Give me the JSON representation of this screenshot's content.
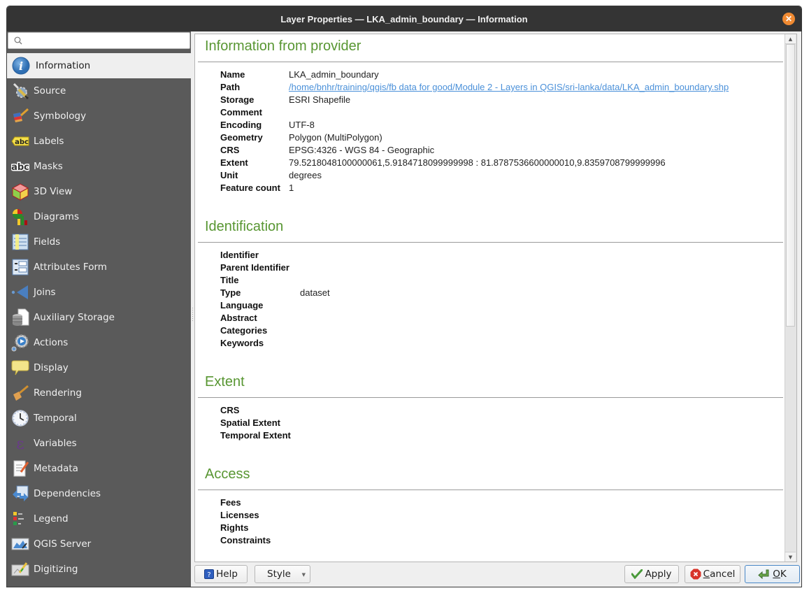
{
  "window": {
    "title": "Layer Properties — LKA_admin_boundary — Information",
    "close_label": "×"
  },
  "sidebar": {
    "search": {
      "value": "",
      "placeholder": ""
    },
    "items": [
      {
        "label": "Information",
        "icon": "info-icon",
        "active": true
      },
      {
        "label": "Source",
        "icon": "source-tools-icon"
      },
      {
        "label": "Symbology",
        "icon": "symbology-brush-icon"
      },
      {
        "label": "Labels",
        "icon": "labels-abc-icon"
      },
      {
        "label": "Masks",
        "icon": "masks-abc-icon"
      },
      {
        "label": "3D View",
        "icon": "cube-3d-icon"
      },
      {
        "label": "Diagrams",
        "icon": "diagrams-icon"
      },
      {
        "label": "Fields",
        "icon": "fields-table-icon"
      },
      {
        "label": "Attributes Form",
        "icon": "attributes-form-icon"
      },
      {
        "label": "Joins",
        "icon": "joins-icon"
      },
      {
        "label": "Auxiliary Storage",
        "icon": "auxiliary-storage-icon"
      },
      {
        "label": "Actions",
        "icon": "actions-gear-icon"
      },
      {
        "label": "Display",
        "icon": "display-speech-bubble-icon"
      },
      {
        "label": "Rendering",
        "icon": "rendering-brush-icon"
      },
      {
        "label": "Temporal",
        "icon": "temporal-clock-icon"
      },
      {
        "label": "Variables",
        "icon": "variables-epsilon-icon"
      },
      {
        "label": "Metadata",
        "icon": "metadata-document-icon"
      },
      {
        "label": "Dependencies",
        "icon": "dependencies-icon"
      },
      {
        "label": "Legend",
        "icon": "legend-icon"
      },
      {
        "label": "QGIS Server",
        "icon": "qgis-server-icon"
      },
      {
        "label": "Digitizing",
        "icon": "digitizing-icon"
      }
    ]
  },
  "content": {
    "sections": [
      {
        "title": "Information from provider",
        "rows": [
          {
            "key": "Name",
            "value": "LKA_admin_boundary"
          },
          {
            "key": "Path",
            "value": "/home/bnhr/training/qgis/fb data for good/Module 2 - Layers in QGIS/sri-lanka/data/LKA_admin_boundary.shp",
            "link": true
          },
          {
            "key": "Storage",
            "value": "ESRI Shapefile"
          },
          {
            "key": "Comment",
            "value": ""
          },
          {
            "key": "Encoding",
            "value": "UTF-8"
          },
          {
            "key": "Geometry",
            "value": "Polygon (MultiPolygon)"
          },
          {
            "key": "CRS",
            "value": "EPSG:4326 - WGS 84 - Geographic"
          },
          {
            "key": "Extent",
            "value": "79.5218048100000061,5.9184718099999998 : 81.8787536600000010,9.8359708799999996"
          },
          {
            "key": "Unit",
            "value": "degrees"
          },
          {
            "key": "Feature count",
            "value": "1"
          }
        ]
      },
      {
        "title": "Identification",
        "rows": [
          {
            "key": "Identifier",
            "value": ""
          },
          {
            "key": "Parent Identifier",
            "value": ""
          },
          {
            "key": "Title",
            "value": ""
          },
          {
            "key": "Type",
            "value": "dataset"
          },
          {
            "key": "Language",
            "value": ""
          },
          {
            "key": "Abstract",
            "value": ""
          },
          {
            "key": "Categories",
            "value": ""
          },
          {
            "key": "Keywords",
            "value": ""
          }
        ]
      },
      {
        "title": "Extent",
        "rows": [
          {
            "key": "CRS",
            "value": ""
          },
          {
            "key": "Spatial Extent",
            "value": ""
          },
          {
            "key": "Temporal Extent",
            "value": ""
          }
        ]
      },
      {
        "title": "Access",
        "rows": [
          {
            "key": "Fees",
            "value": ""
          },
          {
            "key": "Licenses",
            "value": ""
          },
          {
            "key": "Rights",
            "value": ""
          },
          {
            "key": "Constraints",
            "value": ""
          }
        ]
      }
    ],
    "scroll_position_fraction": 0
  },
  "buttons": {
    "help": "Help",
    "style": "Style",
    "apply": "Apply",
    "cancel_prefix": "",
    "cancel_mnemonic": "C",
    "cancel_rest": "ancel",
    "ok_mnemonic": "O",
    "ok_rest": "K"
  },
  "colors": {
    "section_title": "#589632",
    "link": "#4a90d9",
    "sidebar_bg": "#5a5a5a",
    "titlebar_bg": "#343434",
    "close_button": "#f08a32"
  }
}
